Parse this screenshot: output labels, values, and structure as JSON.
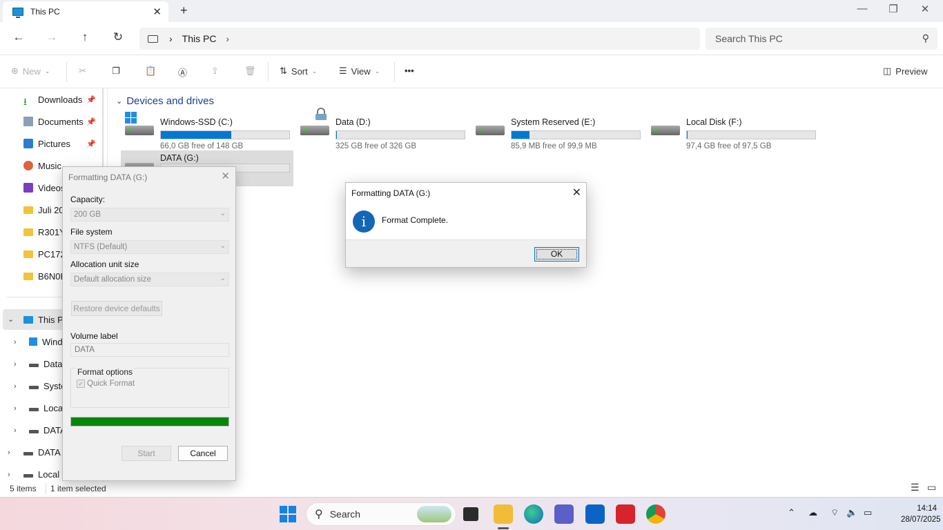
{
  "window": {
    "tab_title": "This PC",
    "tab_close": "✕",
    "new_tab": "+",
    "minimize": "—",
    "maximize": "❐",
    "close": "✕"
  },
  "address": {
    "crumb": "This PC",
    "search_placeholder": "Search This PC"
  },
  "commands": {
    "new": "New",
    "sort": "Sort",
    "view": "View",
    "more": "•••",
    "preview": "Preview"
  },
  "nav": {
    "quick_access": [
      {
        "label": "Downloads",
        "icon": "download-icon",
        "pinned": true
      },
      {
        "label": "Documents",
        "icon": "document-icon",
        "pinned": true
      },
      {
        "label": "Pictures",
        "icon": "picture-icon",
        "pinned": true
      },
      {
        "label": "Music",
        "icon": "music-icon",
        "pinned": true
      },
      {
        "label": "Videos",
        "icon": "video-icon",
        "pinned": false
      },
      {
        "label": "Juli 202",
        "icon": "folder-icon",
        "pinned": false
      },
      {
        "label": "R301Y9",
        "icon": "folder-icon",
        "pinned": false
      },
      {
        "label": "PC172C",
        "icon": "folder-icon",
        "pinned": false
      },
      {
        "label": "B6N0B",
        "icon": "folder-icon",
        "pinned": false
      }
    ],
    "this_pc": "This PC",
    "this_pc_children": [
      "Wind",
      "Data",
      "Syste",
      "Local",
      "DATA"
    ],
    "extra": [
      "DATA (",
      "Local D"
    ]
  },
  "content": {
    "section_title": "Devices and drives",
    "drives": [
      {
        "name": "Windows-SSD (C:)",
        "free": "66,0 GB free of 148 GB",
        "used_fraction": 0.55
      },
      {
        "name": "Data (D:)",
        "free": "325 GB free of 326 GB",
        "used_fraction": 0.003
      },
      {
        "name": "System Reserved (E:)",
        "free": "85,9 MB free of 99,9 MB",
        "used_fraction": 0.14
      },
      {
        "name": "Local Disk (F:)",
        "free": "97,4 GB free of 97,5 GB",
        "used_fraction": 0.001
      },
      {
        "name": "DATA (G:)",
        "free": "",
        "used_fraction": 0.0
      }
    ]
  },
  "status": {
    "items": "5 items",
    "selected": "1 item selected"
  },
  "format_dialog": {
    "title": "Formatting DATA (G:)",
    "capacity_label": "Capacity:",
    "capacity_value": "200 GB",
    "fs_label": "File system",
    "fs_value": "NTFS (Default)",
    "alloc_label": "Allocation unit size",
    "alloc_value": "Default allocation size",
    "restore_button": "Restore device defaults",
    "volume_label": "Volume label",
    "volume_value": "DATA",
    "options_label": "Format options",
    "quick_format": "Quick Format",
    "progress": 1.0,
    "start_button": "Start",
    "cancel_button": "Cancel"
  },
  "message_box": {
    "title": "Formatting DATA (G:)",
    "text": "Format Complete.",
    "ok_button": "OK"
  },
  "taskbar": {
    "search_label": "Search",
    "time": "14:14",
    "date": "28/07/2025"
  },
  "colors": {
    "accent": "#0078d4",
    "progress_green": "#06870c",
    "section_title": "#1c3f8c"
  }
}
